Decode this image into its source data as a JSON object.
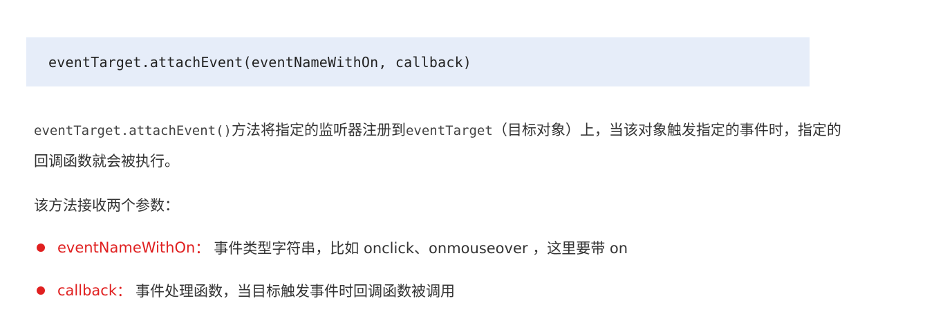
{
  "code_block": {
    "code": "eventTarget.attachEvent(eventNameWithOn, callback)"
  },
  "description": {
    "method_code": "eventTarget.attachEvent()",
    "text_1": "方法将指定的监听器注册到",
    "target_code": "eventTarget",
    "text_2": "（目标对象）上，当该对象触发指定的事件时，指定的回调函数就会被执行。"
  },
  "params_intro": "该方法接收两个参数：",
  "params": [
    {
      "name": "eventNameWithOn",
      "colon": "：",
      "description": "事件类型字符串，比如 onclick、onmouseover ，这里要带 on"
    },
    {
      "name": "callback",
      "colon": "：",
      "description": "事件处理函数，当目标触发事件时回调函数被调用"
    }
  ],
  "colors": {
    "code_background": "#e6edf9",
    "accent_red": "#e02020",
    "text": "#333333"
  }
}
